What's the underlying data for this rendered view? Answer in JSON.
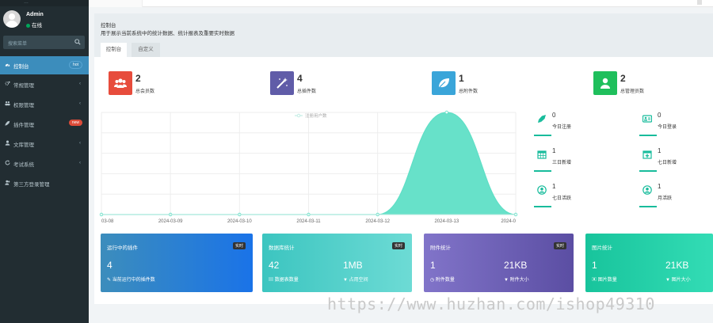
{
  "sidebar": {
    "top_text": "…",
    "user": {
      "name": "Admin",
      "status": "在线"
    },
    "search_placeholder": "搜索菜单",
    "items": [
      {
        "label": "控制台",
        "badge": "hot",
        "icon": "dashboard-icon"
      },
      {
        "label": "常规管理",
        "icon": "cogs-icon"
      },
      {
        "label": "权限管理",
        "icon": "group-icon"
      },
      {
        "label": "插件管理",
        "badge": "new",
        "icon": "rocket-icon"
      },
      {
        "label": "文库管理",
        "icon": "user-icon"
      },
      {
        "label": "考试系统",
        "icon": "refresh-icon"
      },
      {
        "label": "第三方登录管理",
        "icon": "users-icon"
      }
    ]
  },
  "panel": {
    "title": "控制台",
    "desc": "用于展示当前系统中的统计数据、统计报表及重要实时数据",
    "tabs": [
      "控制台",
      "自定义"
    ]
  },
  "stats": [
    {
      "value": "2",
      "label": "总会员数",
      "color": "#e74c3c",
      "icon": "users-icon"
    },
    {
      "value": "4",
      "label": "总插件数",
      "color": "#605ca8",
      "icon": "magic-icon"
    },
    {
      "value": "1",
      "label": "总附件数",
      "color": "#3498db",
      "icon": "leaf-icon"
    },
    {
      "value": "2",
      "label": "总管理员数",
      "color": "#18bc9c",
      "icon": "user-icon"
    }
  ],
  "mini_stats": [
    {
      "value": "0",
      "label": "今日注册",
      "icon": "rocket-icon"
    },
    {
      "value": "0",
      "label": "今日登录",
      "icon": "vcard-icon"
    },
    {
      "value": "1",
      "label": "三日新增",
      "icon": "calendar-icon"
    },
    {
      "value": "1",
      "label": "七日新增",
      "icon": "calendar-plus-icon"
    },
    {
      "value": "1",
      "label": "七日活跃",
      "icon": "user-circle-icon"
    },
    {
      "value": "1",
      "label": "月活跃",
      "icon": "user-circle-icon"
    }
  ],
  "cards": [
    {
      "title": "运行中的插件",
      "tag": "实时",
      "value1": "4",
      "label1": "当前运行中的插件数",
      "value2": "",
      "label2": "",
      "color1": "#3c8dbc",
      "color2": "#1a73e8"
    },
    {
      "title": "数据库统计",
      "tag": "实时",
      "value1": "42",
      "label1": "数据表数量",
      "value2": "1MB",
      "label2": "占用空间",
      "color1": "#3cc5c0",
      "color2": "#63d9d3"
    },
    {
      "title": "附件统计",
      "tag": "实时",
      "value1": "1",
      "label1": "附件数量",
      "value2": "21KB",
      "label2": "附件大小",
      "color1": "#7a6dbf",
      "color2": "#6457ab"
    },
    {
      "title": "图片统计",
      "tag": "实时",
      "value1": "1",
      "label1": "图片数量",
      "value2": "21KB",
      "label2": "图片大小",
      "color1": "#18c49c",
      "color2": "#2fd9b2"
    }
  ],
  "chart_data": {
    "type": "area",
    "x": [
      "03-08",
      "2024-03-09",
      "2024-03-10",
      "2024-03-11",
      "2024-03-12",
      "2024-03-13",
      "2024-0"
    ],
    "series": [
      {
        "name": "注册用户数",
        "values": [
          0,
          0,
          0,
          0,
          0,
          1,
          0
        ]
      }
    ],
    "ylim": [
      0,
      1
    ],
    "legend": "top-center",
    "grid": true,
    "color": "#5fdfc6"
  },
  "watermark": "https://www.huzhan.com/ishop49310"
}
